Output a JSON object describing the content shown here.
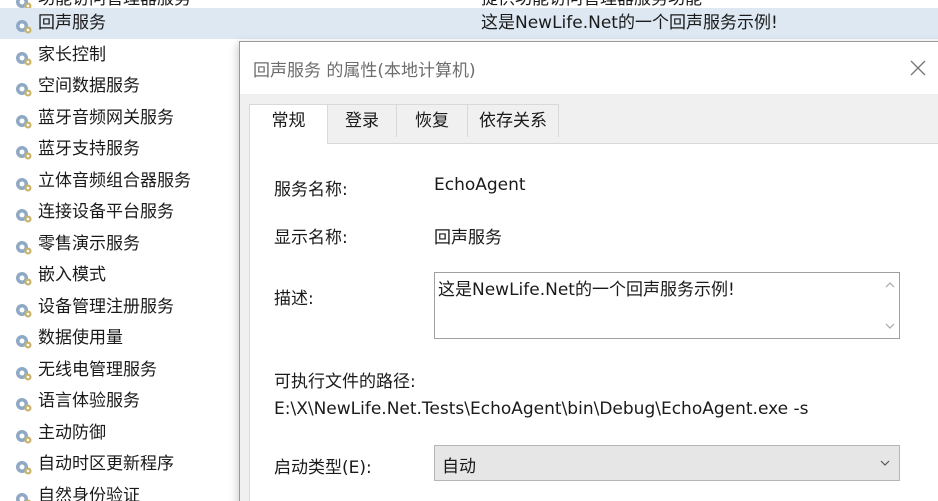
{
  "services": {
    "top_partial": {
      "name": "功能访问管理器服务",
      "desc": "提供功能访问管理器服务功能"
    },
    "rows": [
      {
        "name": "回声服务",
        "desc": "这是NewLife.Net的一个回声服务示例!",
        "selected": true
      },
      {
        "name": "家长控制",
        "desc": ""
      },
      {
        "name": "空间数据服务",
        "desc": ""
      },
      {
        "name": "蓝牙音频网关服务",
        "desc": ""
      },
      {
        "name": "蓝牙支持服务",
        "desc": ""
      },
      {
        "name": "立体音频组合器服务",
        "desc": ""
      },
      {
        "name": "连接设备平台服务",
        "desc": ""
      },
      {
        "name": "零售演示服务",
        "desc": ""
      },
      {
        "name": "嵌入模式",
        "desc": ""
      },
      {
        "name": "设备管理注册服务",
        "desc": ""
      },
      {
        "name": "数据使用量",
        "desc": ""
      },
      {
        "name": "无线电管理服务",
        "desc": ""
      },
      {
        "name": "语言体验服务",
        "desc": ""
      },
      {
        "name": "主动防御",
        "desc": ""
      },
      {
        "name": "自动时区更新程序",
        "desc": ""
      },
      {
        "name": "自然身份验证",
        "desc": ""
      }
    ],
    "icon": "gear-icon"
  },
  "dialog": {
    "title": "回声服务 的属性(本地计算机)",
    "close_icon": "close-icon",
    "tabs": [
      {
        "label": "常规",
        "active": true
      },
      {
        "label": "登录",
        "active": false
      },
      {
        "label": "恢复",
        "active": false
      },
      {
        "label": "依存关系",
        "active": false
      }
    ],
    "general": {
      "service_name_label": "服务名称:",
      "service_name_value": "EchoAgent",
      "display_name_label": "显示名称:",
      "display_name_value": "回声服务",
      "description_label": "描述:",
      "description_value": "这是NewLife.Net的一个回声服务示例!",
      "path_label": "可执行文件的路径:",
      "path_value": "E:\\X\\NewLife.Net.Tests\\EchoAgent\\bin\\Debug\\EchoAgent.exe -s",
      "startup_type_label": "启动类型(E):",
      "startup_type_value": "自动"
    }
  },
  "colors": {
    "selected_row": "#dde8f3",
    "dialog_bg": "#f0f0f0",
    "panel_bg": "#ffffff",
    "title_text": "#6d6d6d"
  }
}
